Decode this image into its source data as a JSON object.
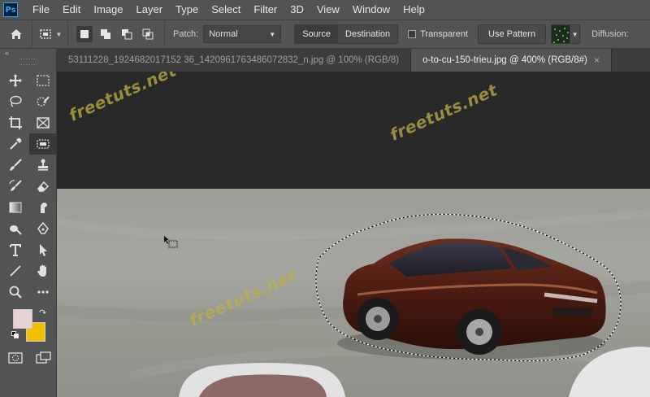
{
  "app": {
    "logo": "Ps"
  },
  "menu": [
    "File",
    "Edit",
    "Image",
    "Layer",
    "Type",
    "Select",
    "Filter",
    "3D",
    "View",
    "Window",
    "Help"
  ],
  "options": {
    "patch_label": "Patch:",
    "patch_mode": "Normal",
    "source_label": "Source",
    "destination_label": "Destination",
    "transparent_label": "Transparent",
    "use_pattern_label": "Use Pattern",
    "diffusion_label": "Diffusion:"
  },
  "toolbar": {
    "collapse_glyph": "«"
  },
  "tabs": [
    {
      "label": "53111228_1924682017152 36_1420961763486072832_n.jpg @ 100% (RGB/8)",
      "active": false
    },
    {
      "label": "o-to-cu-150-trieu.jpg @ 400% (RGB/8#)",
      "active": true
    }
  ],
  "watermark": "freetuts.net",
  "colors": {
    "foreground": "#e8d4d6",
    "background": "#f5c000",
    "accent": "#31a8ff"
  }
}
